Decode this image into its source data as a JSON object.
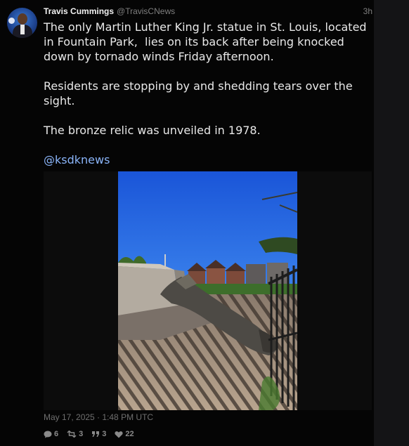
{
  "user": {
    "display_name": "Travis Cummings",
    "handle": "@TravisCNews",
    "time_ago": "3h"
  },
  "tweet": {
    "paragraphs": [
      "The only Martin Luther King Jr. statue in St. Louis, located in Fountain Park,  lies on its back after being knocked down by tornado winds Friday afternoon.",
      "Residents are stopping by and shedding tears over the sight.",
      "The bronze relic was unveiled in 1978."
    ],
    "mention": "@ksdknews",
    "timestamp": "May 17, 2025 · 1:48 PM UTC"
  },
  "stats": {
    "replies": "6",
    "retweets": "3",
    "quotes": "3",
    "likes": "22"
  },
  "icons": {
    "reply": "comment-icon",
    "retweet": "retweet-icon",
    "quote": "quote-icon",
    "like": "heart-icon"
  },
  "colors": {
    "background": "#050505",
    "mention": "#8ab4f8",
    "muted": "#7f7f7f"
  }
}
